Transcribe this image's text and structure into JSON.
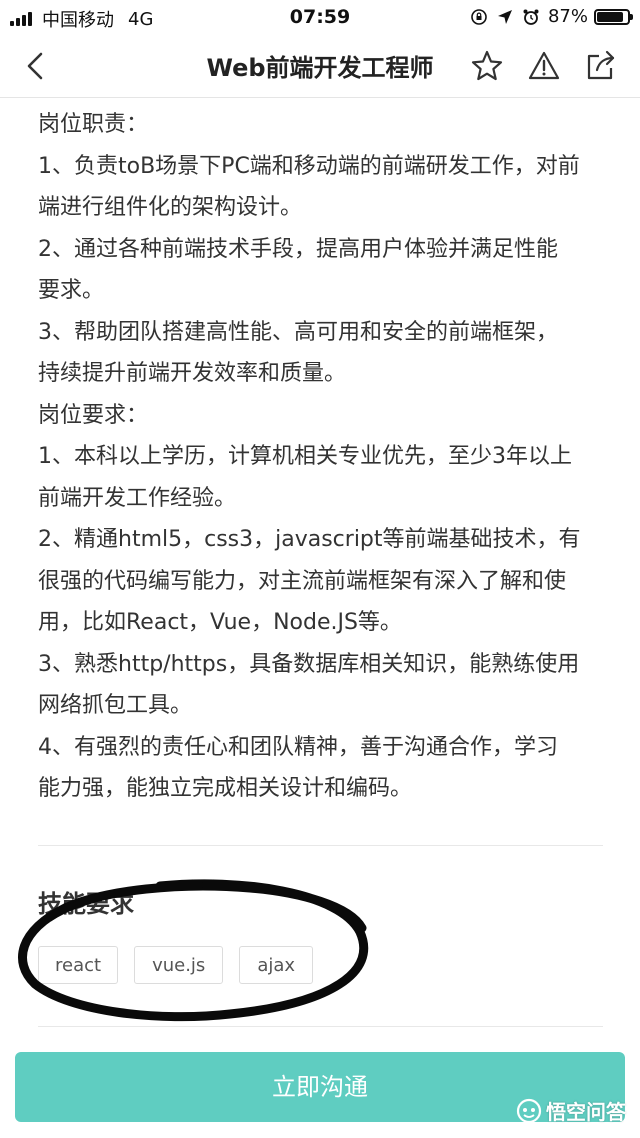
{
  "status_bar": {
    "carrier": "中国移动",
    "network": "4G",
    "time": "07:59",
    "battery_percent": "87%",
    "battery_level": 0.87
  },
  "nav": {
    "title": "Web前端开发工程师",
    "icons": [
      "back-chevron-icon",
      "star-icon",
      "warning-icon",
      "share-icon"
    ]
  },
  "description": {
    "lines": [
      "岗位职责：",
      "1、负责toB场景下PC端和移动端的前端研发工作，对前",
      "端进行组件化的架构设计。",
      "2、通过各种前端技术手段，提高用户体验并满足性能",
      "要求。",
      "3、帮助团队搭建高性能、高可用和安全的前端框架，",
      "持续提升前端开发效率和质量。",
      "岗位要求：",
      "1、本科以上学历，计算机相关专业优先，至少3年以上",
      "前端开发工作经验。",
      "2、精通html5，css3，javascript等前端基础技术，有",
      "很强的代码编写能力，对主流前端框架有深入了解和使",
      "用，比如React，Vue，Node.JS等。",
      "3、熟悉http/https，具备数据库相关知识，能熟练使用",
      "网络抓包工具。",
      "4、有强烈的责任心和团队精神，善于沟通合作，学习",
      "能力强，能独立完成相关设计和编码。"
    ]
  },
  "skills": {
    "title": "技能要求",
    "tags": [
      "react",
      "vue.js",
      "ajax"
    ]
  },
  "bottom": {
    "contact_button": "立即沟通",
    "watermark": "悟空问答"
  },
  "colors": {
    "accent": "#5fcdc1",
    "text": "#333333",
    "divider": "#e8e8e8"
  }
}
